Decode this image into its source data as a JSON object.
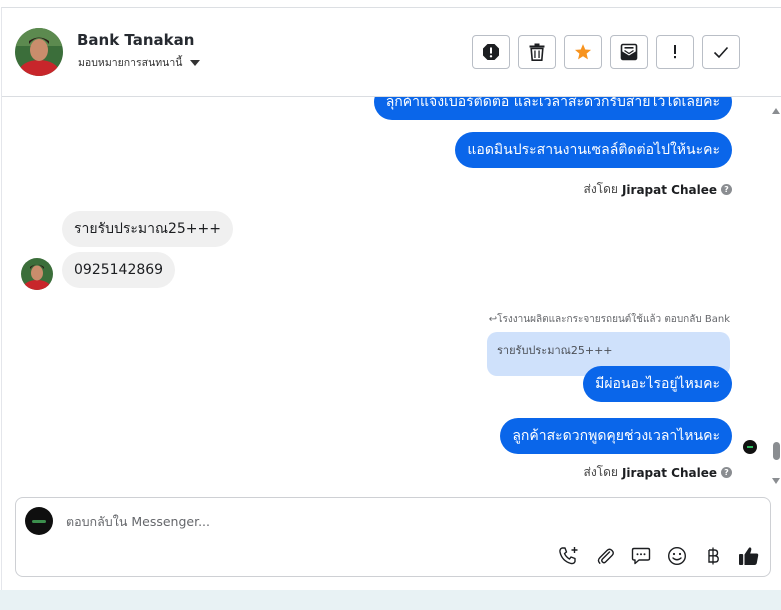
{
  "header": {
    "contact_name": "Bank Tanakan",
    "assign_label": "มอบหมายการสนทนานี้",
    "actions": [
      {
        "name": "report-icon"
      },
      {
        "name": "trash-icon"
      },
      {
        "name": "star-icon"
      },
      {
        "name": "mark-unread-icon"
      },
      {
        "name": "exclamation-icon"
      },
      {
        "name": "check-icon"
      }
    ]
  },
  "messages": {
    "out1": "ลุกค้าแจ้งเบอร์ติดต่อ และเวลาสะดวกรับสายไว้ได้เลยค่ะ",
    "out2": "แอดมินประสานงานเซลล์ติดต่อไปให้นะคะ",
    "sent_by_prefix1": "ส่งโดย",
    "sent_by_name1": "Jirapat Chalee",
    "in1": "รายรับประมาณ25+++",
    "in2": "0925142869",
    "reply_context": "↩โรงงานผลิตและกระจายรถยนต์ใช้แล้ว ตอบกลับ Bank",
    "quoted": "รายรับประมาณ25+++",
    "out3": "มีผ่อนอะไรอยู่ไหมคะ",
    "out4": "ลูกค้าสะดวกพูดคุยช่วงเวลาไหนคะ",
    "sent_by_prefix2": "ส่งโดย",
    "sent_by_name2": "Jirapat Chalee",
    "info_glyph": "?"
  },
  "composer": {
    "placeholder": "ตอบกลับใน Messenger...",
    "value": "",
    "tools": [
      "add-call-icon",
      "attach-icon",
      "saved-replies-icon",
      "emoji-icon",
      "payment-baht-icon",
      "like-icon"
    ]
  },
  "colors": {
    "outgoing_bubble": "#0a66ea",
    "incoming_bubble": "#f0f0f0",
    "star": "#f7931e",
    "quoted_bg": "#cfe1fb"
  }
}
